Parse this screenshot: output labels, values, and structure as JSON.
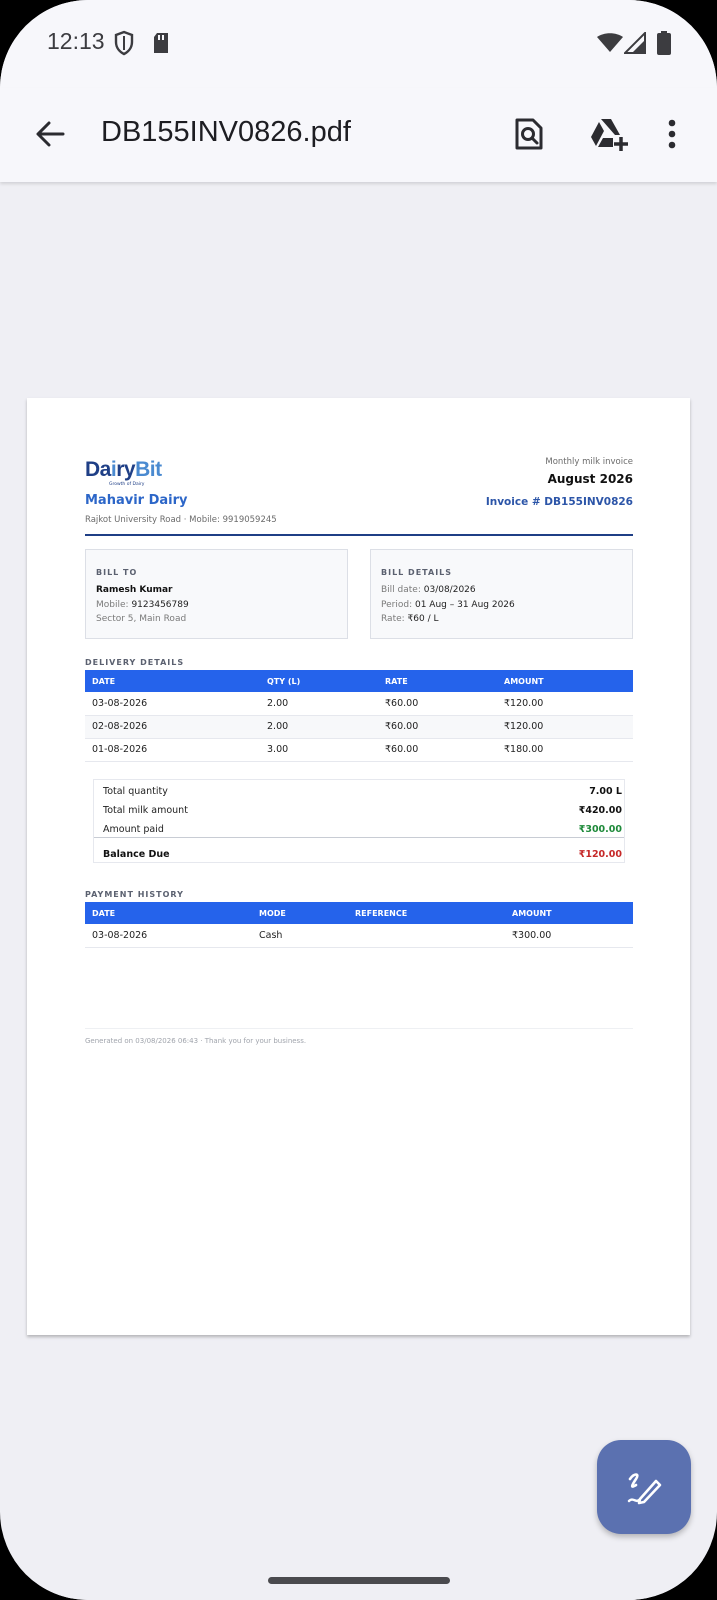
{
  "status_bar": {
    "time": "12:13",
    "left_icons": [
      "shield-icon",
      "sd-card-icon"
    ],
    "right_icons": [
      "wifi-icon",
      "signal-icon",
      "battery-icon"
    ]
  },
  "app_bar": {
    "title": "DB155INV0826.pdf",
    "actions": [
      "search-document-icon",
      "add-to-drive-icon",
      "more-vert-icon"
    ]
  },
  "invoice": {
    "logo_text_1": "Da",
    "logo_text_2": "ry",
    "logo_text_3": "Bit",
    "logo_tagline": "Growth of Dairy",
    "dairy_name": "Mahavir Dairy",
    "dairy_address": "Rajkot University Road · Mobile: 9919059245",
    "kicker": "Monthly milk invoice",
    "month": "August 2026",
    "invoice_number": "Invoice # DB155INV0826",
    "bill_to": {
      "title": "BILL TO",
      "name": "Ramesh Kumar",
      "mobile_label": "Mobile:",
      "mobile": "9123456789",
      "address": "Sector 5, Main Road"
    },
    "bill_details": {
      "title": "BILL DETAILS",
      "date_label": "Bill date:",
      "date": "03/08/2026",
      "period_label": "Period:",
      "period": "01 Aug – 31 Aug 2026",
      "rate_label": "Rate:",
      "rate": "₹60 / L"
    },
    "delivery": {
      "title": "DELIVERY DETAILS",
      "headers": [
        "DATE",
        "QTY (L)",
        "RATE",
        "AMOUNT"
      ],
      "rows": [
        [
          "03-08-2026",
          "2.00",
          "₹60.00",
          "₹120.00"
        ],
        [
          "02-08-2026",
          "2.00",
          "₹60.00",
          "₹120.00"
        ],
        [
          "01-08-2026",
          "3.00",
          "₹60.00",
          "₹180.00"
        ]
      ]
    },
    "totals": {
      "qty_label": "Total quantity",
      "qty": "7.00 L",
      "amount_label": "Total milk amount",
      "amount": "₹420.00",
      "paid_label": "Amount paid",
      "paid": "₹300.00",
      "balance_label": "Balance Due",
      "balance": "₹120.00"
    },
    "payments": {
      "title": "PAYMENT HISTORY",
      "headers": [
        "DATE",
        "MODE",
        "REFERENCE",
        "AMOUNT"
      ],
      "rows": [
        [
          "03-08-2026",
          "Cash",
          "",
          "₹300.00"
        ]
      ]
    },
    "footer": "Generated on 03/08/2026 06:43 · Thank you for your business."
  },
  "fab": {
    "icon": "edit-signature-icon"
  },
  "colors": {
    "accent": "#2563eb",
    "brand": "#1f3f86",
    "paid": "#1e8a3a",
    "due": "#c62828",
    "fab": "#5b71b0"
  }
}
